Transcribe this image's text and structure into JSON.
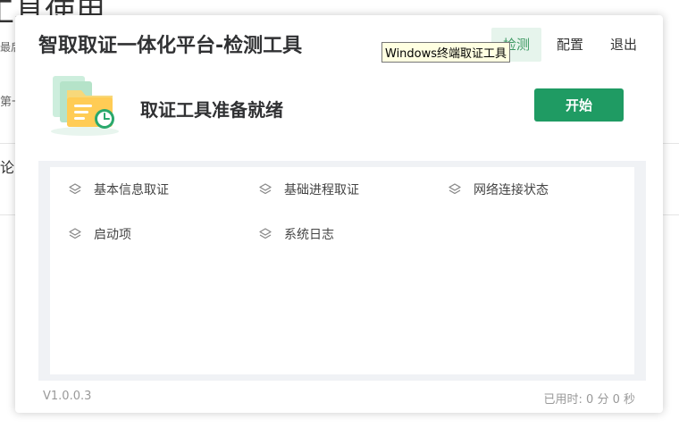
{
  "background": {
    "heading": "工具使用",
    "frag1": "最后",
    "frag2": "第一",
    "frag3": "论"
  },
  "window": {
    "title": "智取取证一体化平台-检测工具",
    "nav": [
      {
        "label": "检测",
        "active": true
      },
      {
        "label": "配置",
        "active": false
      },
      {
        "label": "退出",
        "active": false
      }
    ],
    "tooltip": "Windows终端取证工具",
    "status": "取证工具准备就绪",
    "start_label": "开始",
    "items": [
      "基本信息取证",
      "基础进程取证",
      "网络连接状态",
      "启动项",
      "系统日志"
    ],
    "item_icon": "layers-icon",
    "version": "V1.0.0.3",
    "elapsed": "已用时: 0 分 0 秒"
  },
  "colors": {
    "accent": "#1f9b63",
    "nav_active_bg": "#e6f4ec",
    "nav_active_text": "#3f9a64"
  }
}
